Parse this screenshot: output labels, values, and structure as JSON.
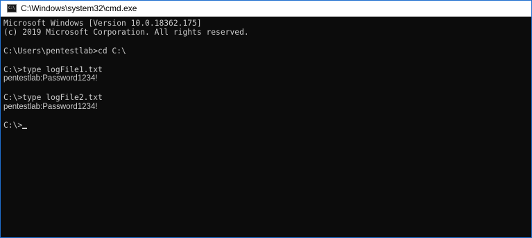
{
  "window": {
    "title": "C:\\Windows\\system32\\cmd.exe",
    "icon": "console-icon",
    "icon_glyph": "C:\\"
  },
  "console": {
    "lines": [
      "Microsoft Windows [Version 10.0.18362.175]",
      "(c) 2019 Microsoft Corporation. All rights reserved.",
      "",
      "C:\\Users\\pentestlab>cd C:\\",
      "",
      "C:\\>type logFile1.txt",
      "pentestlab:Password1234!",
      "",
      "C:\\>type logFile2.txt",
      "pentestlab:Password1234!",
      ""
    ],
    "prompt": "C:\\>"
  },
  "colors": {
    "console_background": "#0c0c0c",
    "console_text": "#cccccc",
    "window_border": "#1f6fcf"
  }
}
